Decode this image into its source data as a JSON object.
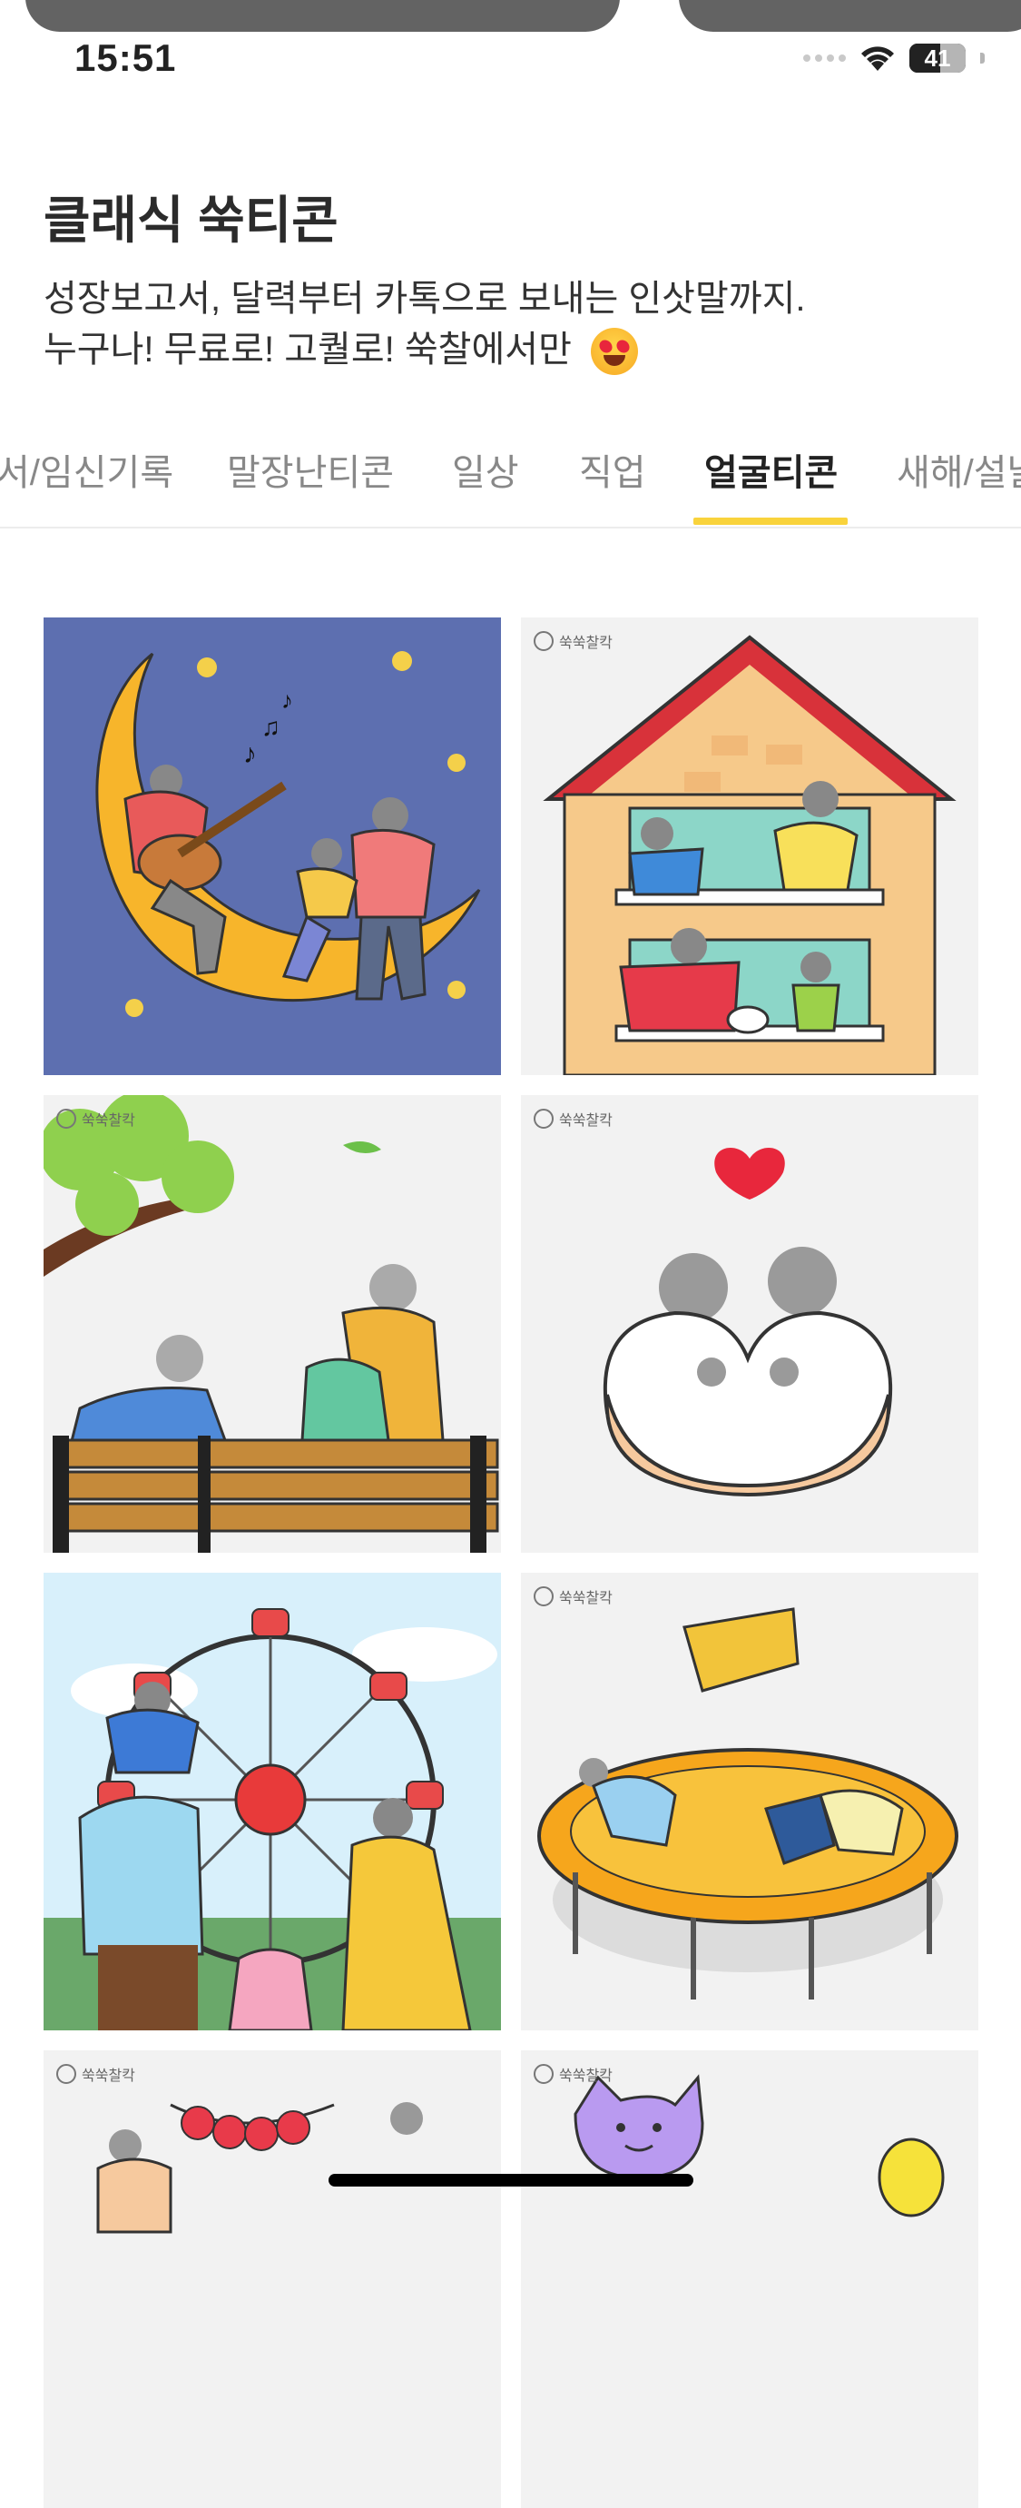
{
  "status_bar": {
    "time": "15:51",
    "battery": "41"
  },
  "header": {
    "title": "클래식 쑥티콘",
    "desc_line1": "성장보고서, 달력부터 카톡으로 보내는 인삿말까지.",
    "desc_line2": "누구나! 무료로! 고퀄로! 쑥찰에서만"
  },
  "tabs": [
    {
      "label": "서/임신기록"
    },
    {
      "label": "말장난티콘"
    },
    {
      "label": "일상"
    },
    {
      "label": "직업"
    },
    {
      "label": "얼굴티콘",
      "active": true
    },
    {
      "label": "새해/설날"
    }
  ],
  "watermark": "쑥쑥찰칵",
  "colors": {
    "accent": "#f9d33c",
    "moon_bg": "#5d6fb0"
  }
}
